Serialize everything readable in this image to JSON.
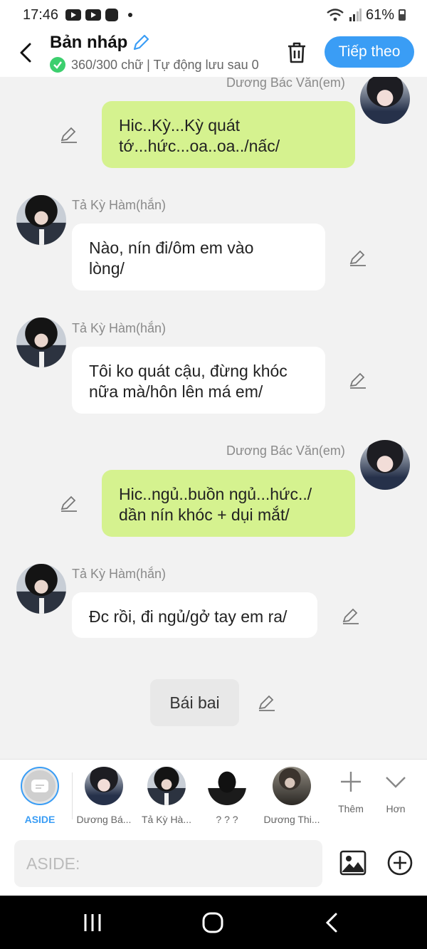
{
  "status_bar": {
    "time": "17:46",
    "battery": "61%"
  },
  "header": {
    "title": "Bản nháp",
    "subtitle": "360/300 chữ | Tự động lưu sau 0",
    "next_label": "Tiếp theo"
  },
  "messages": [
    {
      "sender": "Dương Bác Văn(em)",
      "side": "right",
      "text_lines": [
        "Hic..Kỳ...Kỳ quát",
        "tớ...hức...oa..oa../nấc/"
      ]
    },
    {
      "sender": "Tả Kỳ Hàm(hắn)",
      "side": "left",
      "text_lines": [
        "Nào, nín đi/ôm em vào",
        "lòng/"
      ]
    },
    {
      "sender": "Tả Kỳ Hàm(hắn)",
      "side": "left",
      "text_lines": [
        "Tôi ko quát cậu, đừng khóc",
        "nữa mà/hôn lên má em/"
      ]
    },
    {
      "sender": "Dương Bác Văn(em)",
      "side": "right",
      "text_lines": [
        "Hic..ngủ..buồn ngủ...hức../",
        "dần nín khóc + dụi mắt/"
      ]
    },
    {
      "sender": "Tả Kỳ Hàm(hắn)",
      "side": "left",
      "text_lines": [
        "Đc rồi, đi ngủ/gở tay em ra/"
      ]
    }
  ],
  "aside_message": "Bái bai",
  "characters": [
    {
      "label": "ASIDE",
      "active": true
    },
    {
      "label": "Dương Bá...",
      "active": false
    },
    {
      "label": "Tả Kỳ Hà...",
      "active": false
    },
    {
      "label": "? ? ?",
      "active": false
    },
    {
      "label": "Dương Thi...",
      "active": false
    }
  ],
  "tools": {
    "add_label": "Thêm",
    "more_label": "Hơn"
  },
  "input": {
    "placeholder": "ASIDE:"
  },
  "colors": {
    "accent": "#3a9df5",
    "my_bubble": "#d5f28f",
    "other_bubble": "#ffffff",
    "background": "#f2f2f2"
  }
}
